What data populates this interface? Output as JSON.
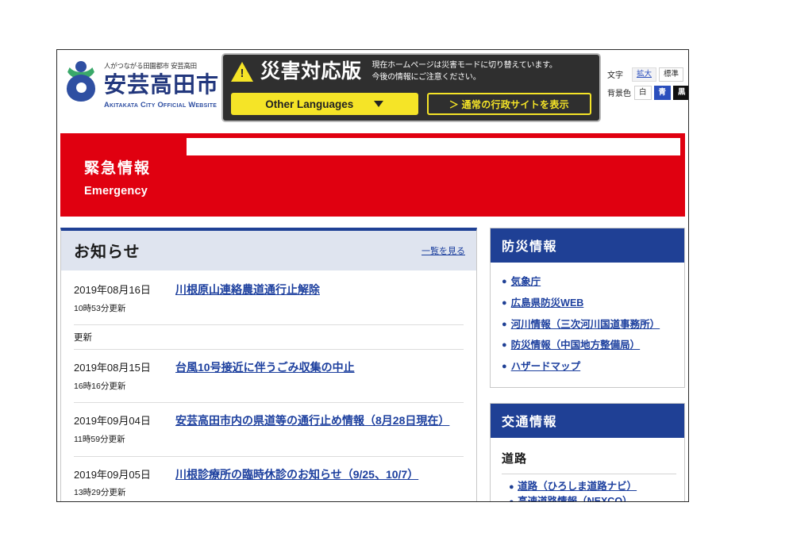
{
  "site": {
    "logo": {
      "tagline": "人がつながる田園都市 安芸高田",
      "name": "安芸高田市",
      "english": "Akitakata City Official Website",
      "icon": "city-logo-icon"
    }
  },
  "disaster_banner": {
    "warning_icon": "warning-triangle-icon",
    "title": "災害対応版",
    "description_line1": "現在ホームページは災害モードに切り替えています。",
    "description_line2": "今後の情報にご注意ください。",
    "language_button": "Other Languages",
    "language_caret_icon": "chevron-down-icon",
    "normal_site_button": "＞ 通常の行政サイトを表示"
  },
  "accessibility": {
    "text_label": "文字",
    "text_options": [
      "拡大",
      "標準"
    ],
    "text_selected": "拡大",
    "background_label": "背景色",
    "background_options": [
      "白",
      "青",
      "黒"
    ],
    "background_selected": "青"
  },
  "emergency": {
    "title_jp": "緊急情報",
    "title_en": "Emergency",
    "input_value": "",
    "input_placeholder": "",
    "background_color": "#e00010"
  },
  "notices": {
    "title": "お知らせ",
    "more_link": "一覧を見る",
    "items": [
      {
        "date": "2019年08月16日",
        "time": "10時53分更新",
        "link": "川根原山連絡農道通行止解除"
      },
      {
        "label": "更新"
      },
      {
        "date": "2019年08月15日",
        "time": "16時16分更新",
        "link": "台風10号接近に伴うごみ収集の中止"
      },
      {
        "date": "2019年09月04日",
        "time": "11時59分更新",
        "link": "安芸高田市内の県道等の通行止め情報（8月28日現在）"
      },
      {
        "date": "2019年09月05日",
        "time": "13時29分更新",
        "link": "川根診療所の臨時休診のお知らせ（9/25、10/7）"
      }
    ]
  },
  "sidebar": {
    "disaster_info": {
      "title": "防災情報",
      "links": [
        "気象庁",
        "広島県防災WEB",
        "河川情報（三次河川国道事務所）",
        "防災情報（中国地方整備局）",
        "ハザードマップ"
      ]
    },
    "traffic_info": {
      "title": "交通情報",
      "subhead": "道路",
      "links": [
        "道路（ひろしま道路ナビ）",
        "高速道路情報（NEXCO）"
      ]
    }
  },
  "theme": {
    "navy": "#1f4095",
    "red": "#e00010",
    "yellow": "#f5e427",
    "link_blue": "#1c3f9e",
    "dark": "#2f2f2f"
  }
}
